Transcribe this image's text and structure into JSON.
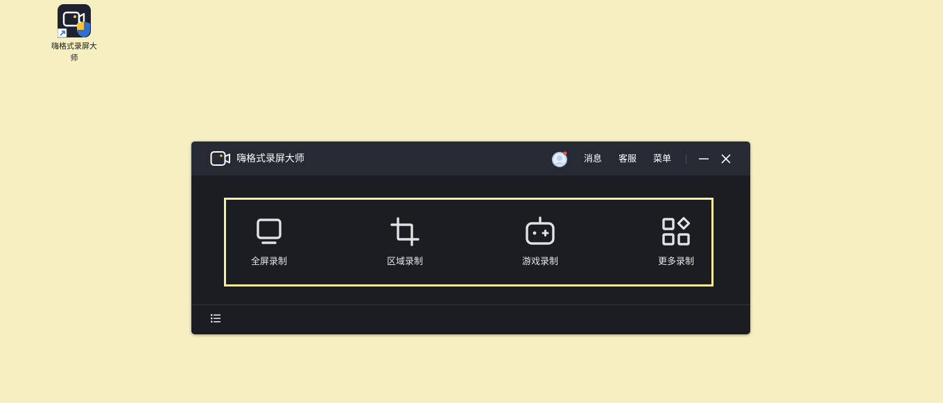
{
  "desktop": {
    "background": "#f6efc2",
    "shortcut": {
      "label": "嗨格式录屏大师",
      "icon": "app-shortcut-icon"
    }
  },
  "window": {
    "title": "嗨格式录屏大师",
    "logo_icon": "video-camera-icon",
    "header": {
      "messages": "消息",
      "support": "客服",
      "menu": "菜单"
    },
    "controls": {
      "minimize_icon": "minimize-icon",
      "close_icon": "close-icon"
    },
    "modes": [
      {
        "label": "全屏录制",
        "icon": "monitor-icon"
      },
      {
        "label": "区域录制",
        "icon": "crop-icon"
      },
      {
        "label": "游戏录制",
        "icon": "gamepad-icon"
      },
      {
        "label": "更多录制",
        "icon": "apps-grid-icon"
      }
    ],
    "footer": {
      "list_icon": "list-icon"
    },
    "colors": {
      "titlebar": "#262a33",
      "body": "#1c1d22",
      "highlight_border": "#f7f19b",
      "logo_accent": "#f5c542"
    }
  }
}
